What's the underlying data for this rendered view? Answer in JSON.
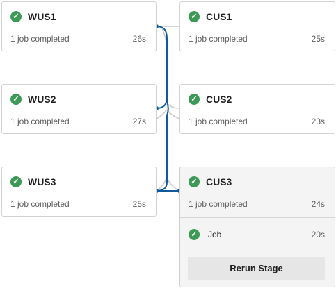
{
  "stages_left": [
    {
      "name": "WUS1",
      "status": "1 job completed",
      "duration": "26s"
    },
    {
      "name": "WUS2",
      "status": "1 job completed",
      "duration": "27s"
    },
    {
      "name": "WUS3",
      "status": "1 job completed",
      "duration": "25s"
    }
  ],
  "stages_right": [
    {
      "name": "CUS1",
      "status": "1 job completed",
      "duration": "25s"
    },
    {
      "name": "CUS2",
      "status": "1 job completed",
      "duration": "23s"
    },
    {
      "name": "CUS3",
      "status": "1 job completed",
      "duration": "24s"
    }
  ],
  "expanded_stage": {
    "job": {
      "name": "Job",
      "duration": "20s"
    },
    "rerun_label": "Rerun Stage"
  },
  "colors": {
    "success": "#3c9a56",
    "connector_active": "#0f5a9c",
    "connector_inactive": "#c8c8c8"
  },
  "icons": {
    "status": "check-circle-icon"
  }
}
